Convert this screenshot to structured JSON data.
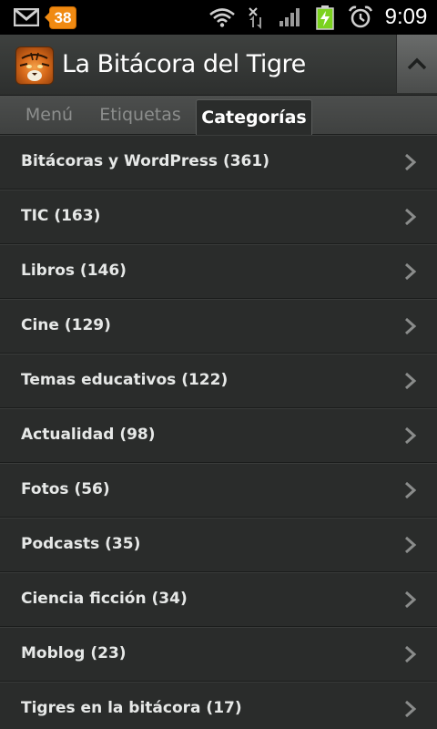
{
  "status_bar": {
    "gmail_icon": "gmail-icon",
    "notification_count": "38",
    "wifi_icon": "wifi-icon",
    "data_icon": "data-transfer-icon",
    "signal_icon": "signal-icon",
    "battery_icon": "battery-charging-icon",
    "alarm_icon": "alarm-icon",
    "time": "9:09"
  },
  "header": {
    "title": "La Bitácora del Tigre",
    "icon": "tiger-app-icon",
    "collapse_icon": "chevron-up-icon"
  },
  "tabs": [
    {
      "label": "Menú",
      "active": false
    },
    {
      "label": "Etiquetas",
      "active": false
    },
    {
      "label": "Categorías",
      "active": true
    }
  ],
  "categories": [
    {
      "label": "Bitácoras y WordPress (361)"
    },
    {
      "label": "TIC (163)"
    },
    {
      "label": "Libros (146)"
    },
    {
      "label": "Cine (129)"
    },
    {
      "label": "Temas educativos (122)"
    },
    {
      "label": "Actualidad (98)"
    },
    {
      "label": "Fotos (56)"
    },
    {
      "label": "Podcasts (35)"
    },
    {
      "label": "Ciencia ficción (34)"
    },
    {
      "label": "Moblog (23)"
    },
    {
      "label": "Tigres en la bitácora (17)"
    }
  ],
  "colors": {
    "badge": "#f08a12",
    "background": "#2a2c2b",
    "battery": "#7bd21e"
  }
}
